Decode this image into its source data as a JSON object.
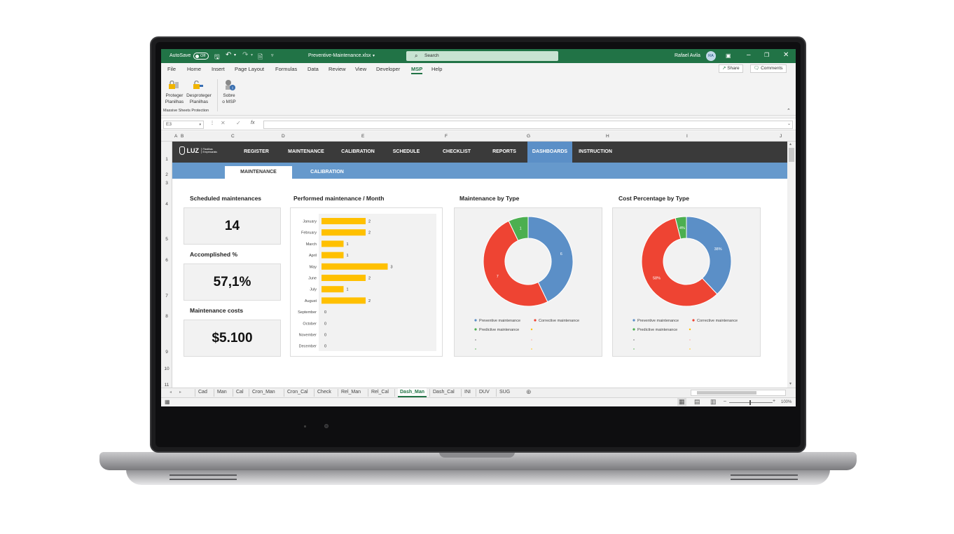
{
  "titlebar": {
    "autosave_label": "AutoSave",
    "autosave_state": "Off",
    "filename": "Preventive-Maintenance.xlsx",
    "search_placeholder": "Search",
    "user_name": "Rafael Avila",
    "user_initials": "RA"
  },
  "menu": {
    "items": [
      "File",
      "Home",
      "Insert",
      "Page Layout",
      "Formulas",
      "Data",
      "Review",
      "View",
      "Developer",
      "MSP",
      "Help"
    ],
    "active": "MSP",
    "share_label": "Share",
    "comments_label": "Comments"
  },
  "ribbon": {
    "btn1_line1": "Proteger",
    "btn1_line2": "Planilhas",
    "btn2_line1": "Desproteger",
    "btn2_line2": "Planilhas",
    "btn3_line1": "Sobre",
    "btn3_line2": "o MSP",
    "group_label": "Massive Sheets Protection"
  },
  "formula_bar": {
    "name_box": "E3",
    "fx": "fx"
  },
  "columns": [
    "A",
    "B",
    "C",
    "D",
    "E",
    "F",
    "G",
    "H",
    "I",
    "J"
  ],
  "rows": [
    "1",
    "2",
    "3",
    "4",
    "5",
    "6",
    "7",
    "8",
    "9",
    "10",
    "11"
  ],
  "dashboard": {
    "logo_text": "LUZ",
    "logo_sub": "Planilhas Empresariais",
    "nav": [
      "REGISTER",
      "MAINTENANCE",
      "CALIBRATION",
      "SCHEDULE",
      "CHECKLIST",
      "REPORTS",
      "DASHBOARDS",
      "INSTRUCTION"
    ],
    "nav_active": "DASHBOARDS",
    "subtabs": [
      "MAINTENANCE",
      "CALIBRATION"
    ],
    "subtab_active": "MAINTENANCE",
    "kpis": [
      {
        "title": "Scheduled maintenances",
        "value": "14"
      },
      {
        "title": "Accomplished %",
        "value": "57,1%"
      },
      {
        "title": "Maintenance costs",
        "value": "$5.100"
      }
    ]
  },
  "chart_data": [
    {
      "type": "bar",
      "orientation": "horizontal",
      "title": "Performed maintenance / Month",
      "categories": [
        "January",
        "February",
        "March",
        "April",
        "May",
        "June",
        "July",
        "August",
        "September",
        "October",
        "November",
        "December"
      ],
      "values": [
        2,
        2,
        1,
        1,
        3,
        2,
        1,
        2,
        0,
        0,
        0,
        0
      ],
      "color": "#ffc000",
      "grid": false
    },
    {
      "type": "pie",
      "donut": true,
      "title": "Maintenance by Type",
      "labels": [
        "Preventive maintenance",
        "Corrective maintenance",
        "Predictive maintenance"
      ],
      "values": [
        6,
        7,
        1
      ],
      "data_labels": [
        "6",
        "7",
        "1"
      ],
      "colors": [
        "#5b8fc7",
        "#ee4433",
        "#4caf50"
      ],
      "legend": "bottom"
    },
    {
      "type": "pie",
      "donut": true,
      "title": "Cost Percentage by Type",
      "labels": [
        "Preventive maintenance",
        "Corrective maintenance",
        "Predictive maintenance"
      ],
      "values": [
        38,
        58,
        4
      ],
      "data_labels": [
        "38%",
        "58%",
        "4%"
      ],
      "colors": [
        "#5b8fc7",
        "#ee4433",
        "#4caf50"
      ],
      "legend": "bottom"
    }
  ],
  "sheet_tabs": [
    "Cad",
    "Man",
    "Cal",
    "Cron_Man",
    "Cron_Cal",
    "Check",
    "Rel_Man",
    "Rel_Cal",
    "Dash_Man",
    "Dash_Cal",
    "INI",
    "DUV",
    "SUG"
  ],
  "sheet_tab_active": "Dash_Man",
  "status": {
    "zoom": "100%"
  },
  "colors": {
    "excel_green": "#217346",
    "nav_dark": "#3a3a3a",
    "accent_blue": "#5b8fc7",
    "bar_yellow": "#ffc000"
  }
}
